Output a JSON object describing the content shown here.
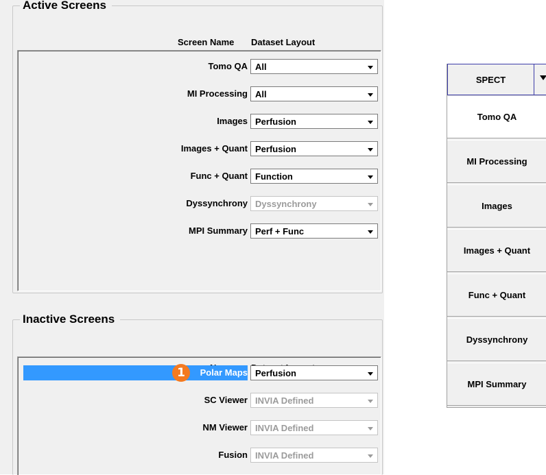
{
  "active": {
    "title": "Active Screens",
    "col_screen": "Screen Name",
    "col_layout": "Dataset Layout",
    "rows": [
      {
        "name": "Tomo QA",
        "layout": "All",
        "enabled": true
      },
      {
        "name": "MI Processing",
        "layout": "All",
        "enabled": true
      },
      {
        "name": "Images",
        "layout": "Perfusion",
        "enabled": true
      },
      {
        "name": "Images + Quant",
        "layout": "Perfusion",
        "enabled": true
      },
      {
        "name": "Func + Quant",
        "layout": "Function",
        "enabled": true
      },
      {
        "name": "Dyssynchrony",
        "layout": "Dyssynchrony",
        "enabled": false
      },
      {
        "name": "MPI Summary",
        "layout": "Perf + Func",
        "enabled": true
      }
    ]
  },
  "inactive": {
    "title": "Inactive Screens",
    "col_screen": "Screen Name",
    "col_layout": "Dataset Layout",
    "badge": "1",
    "rows": [
      {
        "name": "Polar Maps",
        "layout": "Perfusion",
        "enabled": true,
        "selected": true
      },
      {
        "name": "SC Viewer",
        "layout": "INVIA Defined",
        "enabled": false
      },
      {
        "name": "NM Viewer",
        "layout": "INVIA Defined",
        "enabled": false
      },
      {
        "name": "Fusion",
        "layout": "INVIA Defined",
        "enabled": false
      }
    ]
  },
  "sidebar": {
    "mode_label": "SPECT",
    "tabs": [
      "Tomo QA",
      "MI Processing",
      "Images",
      "Images + Quant",
      "Func + Quant",
      "Dyssynchrony",
      "MPI Summary"
    ],
    "active_tab": "Tomo QA"
  },
  "colors": {
    "selection": "#3399ff",
    "badge": "#f47a20",
    "panel": "#f0f0f0"
  }
}
